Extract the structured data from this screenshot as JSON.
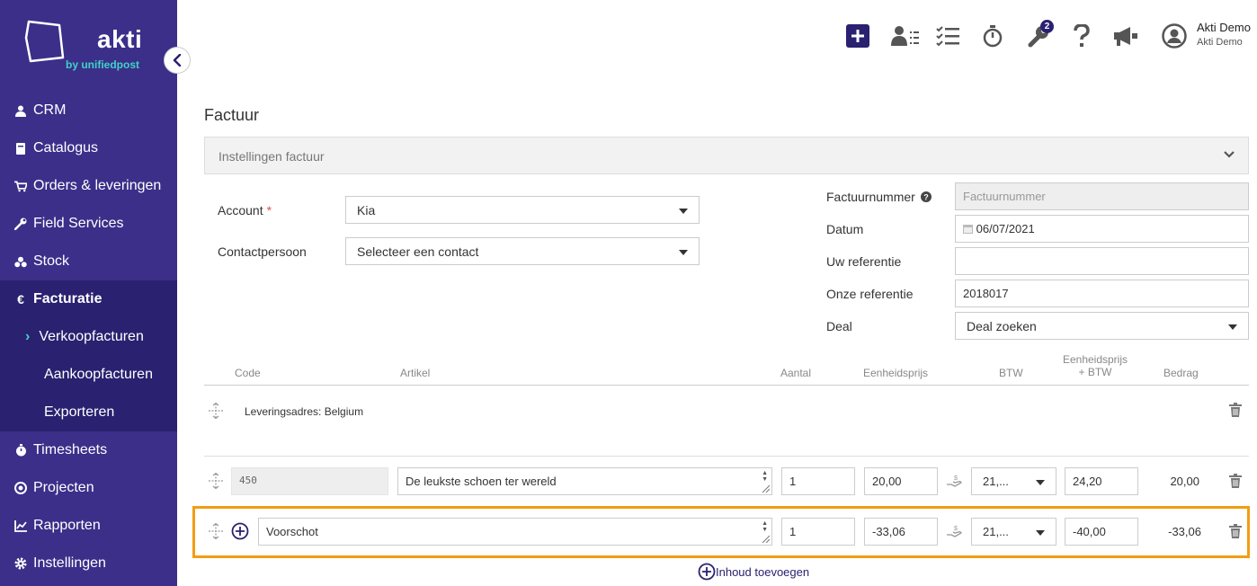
{
  "brand": {
    "name": "akti",
    "sub": "by unifiedpost"
  },
  "sidebar": {
    "items": [
      {
        "label": "CRM",
        "icon": "user-icon"
      },
      {
        "label": "Catalogus",
        "icon": "book-icon"
      },
      {
        "label": "Orders & leveringen",
        "icon": "cart-icon"
      },
      {
        "label": "Field Services",
        "icon": "wrench-icon"
      },
      {
        "label": "Stock",
        "icon": "boxes-icon"
      },
      {
        "label": "Facturatie",
        "icon": "euro-icon"
      },
      {
        "label": "Timesheets",
        "icon": "stopwatch-icon"
      },
      {
        "label": "Projecten",
        "icon": "target-icon"
      },
      {
        "label": "Rapporten",
        "icon": "chart-icon"
      },
      {
        "label": "Instellingen",
        "icon": "gear-icon"
      }
    ],
    "sub_items": [
      {
        "label": "Verkoopfacturen"
      },
      {
        "label": "Aankoopfacturen"
      },
      {
        "label": "Exporteren"
      }
    ]
  },
  "topbar": {
    "badge_count": "2",
    "user_name": "Akti Demo",
    "user_company": "Akti Demo"
  },
  "page": {
    "title": "Factuur",
    "settings_label": "Instellingen factuur"
  },
  "form": {
    "account_label": "Account",
    "required_mark": "*",
    "account_value": "Kia",
    "contact_label": "Contactpersoon",
    "contact_value": "Selecteer een contact",
    "invoice_number_label": "Factuurnummer",
    "invoice_number_placeholder": "Factuurnummer",
    "date_label": "Datum",
    "date_value": "06/07/2021",
    "your_ref_label": "Uw referentie",
    "your_ref_value": "",
    "our_ref_label": "Onze referentie",
    "our_ref_value": "2018017",
    "deal_label": "Deal",
    "deal_value": "Deal zoeken"
  },
  "table": {
    "headers": {
      "code": "Code",
      "article": "Artikel",
      "qty": "Aantal",
      "unit_price": "Eenheidsprijs",
      "vat": "BTW",
      "unit_price_vat_1": "Eenheidsprijs",
      "unit_price_vat_2": "+ BTW",
      "amount": "Bedrag"
    },
    "delivery_address": "Leveringsadres: Belgium",
    "rows": [
      {
        "code": "450",
        "article": "De leukste schoen ter wereld",
        "qty": "1",
        "unit_price": "20,00",
        "vat": "21,...",
        "unit_price_vat": "24,20",
        "amount": "20,00"
      },
      {
        "code": "",
        "article": "Voorschot",
        "qty": "1",
        "unit_price": "-33,06",
        "vat": "21,...",
        "unit_price_vat": "-40,00",
        "amount": "-33,06"
      }
    ],
    "add_content_label": "Inhoud toevoegen"
  },
  "colors": {
    "sidebar": "#3b2f8a",
    "sidebar_active": "#2a2170",
    "accent_teal": "#3fd3c6",
    "highlight": "#f39c12"
  }
}
